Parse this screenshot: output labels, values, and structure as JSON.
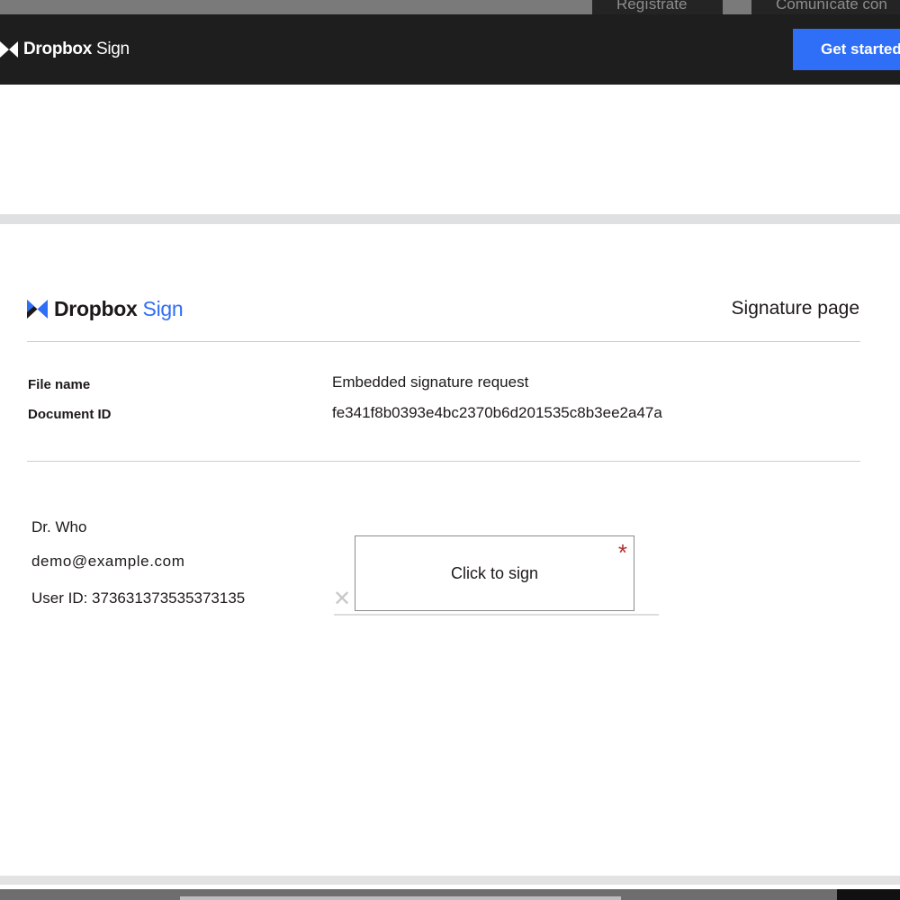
{
  "top_strip": {
    "register_label": "Regístrate",
    "contact_label": "Comunícate con"
  },
  "header": {
    "logo": {
      "brand": "Dropbox",
      "product": "Sign",
      "icon": "dropbox-logo-icon"
    },
    "cta_label": "Get started",
    "cta_color": "#2f6ef6"
  },
  "document": {
    "logo": {
      "brand": "Dropbox",
      "product": "Sign",
      "icon": "dropbox-logo-icon"
    },
    "page_title": "Signature page",
    "fields": {
      "file_name_label": "File name",
      "file_name_value": "Embedded signature request",
      "document_id_label": "Document ID",
      "document_id_value": "fe341f8b0393e4bc2370b6d201535c8b3ee2a47a"
    },
    "signer": {
      "name": "Dr. Who",
      "email": "demo@example.com",
      "user_id": "User ID: 373631373535373135"
    },
    "signature": {
      "mark": "✕",
      "button_label": "Click to sign",
      "required_marker": "*",
      "required_color": "#b22f2f"
    }
  }
}
